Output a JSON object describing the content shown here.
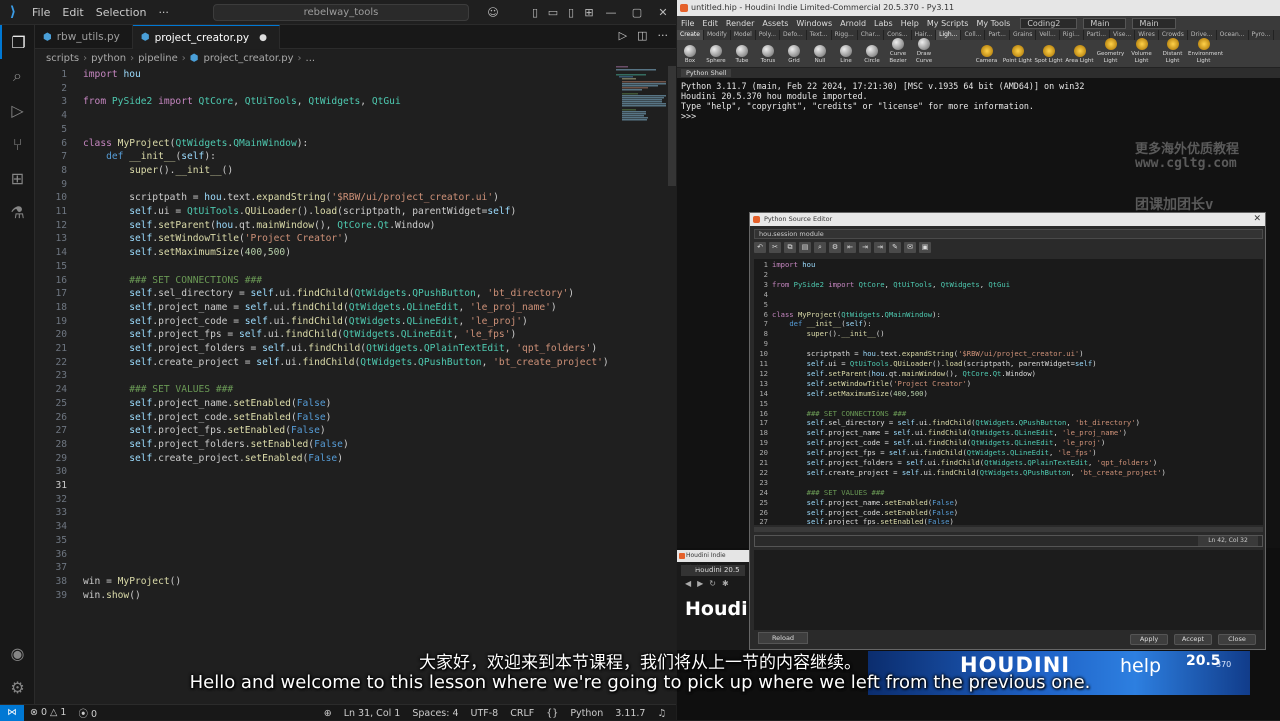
{
  "vscode": {
    "menu": [
      "File",
      "Edit",
      "Selection"
    ],
    "search": "rebelway_tools",
    "tabs": [
      {
        "label": "rbw_utils.py",
        "active": false
      },
      {
        "label": "project_creator.py",
        "active": true,
        "modified": true
      }
    ],
    "breadcrumb": [
      "scripts",
      "python",
      "pipeline",
      "project_creator.py",
      "..."
    ],
    "code": [
      {
        "n": "1",
        "t": "import hou"
      },
      {
        "n": "2",
        "t": ""
      },
      {
        "n": "3",
        "t": "from PySide2 import QtCore, QtUiTools, QtWidgets, QtGui"
      },
      {
        "n": "4",
        "t": ""
      },
      {
        "n": "5",
        "t": ""
      },
      {
        "n": "6",
        "t": "class MyProject(QtWidgets.QMainWindow):"
      },
      {
        "n": "7",
        "t": "    def __init__(self):"
      },
      {
        "n": "8",
        "t": "        super().__init__()"
      },
      {
        "n": "9",
        "t": ""
      },
      {
        "n": "10",
        "t": "        scriptpath = hou.text.expandString('$RBW/ui/project_creator.ui')"
      },
      {
        "n": "11",
        "t": "        self.ui = QtUiTools.QUiLoader().load(scriptpath, parentWidget=self)"
      },
      {
        "n": "12",
        "t": "        self.setParent(hou.qt.mainWindow(), QtCore.Qt.Window)"
      },
      {
        "n": "13",
        "t": "        self.setWindowTitle('Project Creator')"
      },
      {
        "n": "14",
        "t": "        self.setMaximumSize(400,500)"
      },
      {
        "n": "15",
        "t": ""
      },
      {
        "n": "16",
        "t": "        ### SET CONNECTIONS ###"
      },
      {
        "n": "17",
        "t": "        self.sel_directory = self.ui.findChild(QtWidgets.QPushButton, 'bt_directory')"
      },
      {
        "n": "18",
        "t": "        self.project_name = self.ui.findChild(QtWidgets.QLineEdit, 'le_proj_name')"
      },
      {
        "n": "19",
        "t": "        self.project_code = self.ui.findChild(QtWidgets.QLineEdit, 'le_proj')"
      },
      {
        "n": "20",
        "t": "        self.project_fps = self.ui.findChild(QtWidgets.QLineEdit, 'le_fps')"
      },
      {
        "n": "21",
        "t": "        self.project_folders = self.ui.findChild(QtWidgets.QPlainTextEdit, 'qpt_folders')"
      },
      {
        "n": "22",
        "t": "        self.create_project = self.ui.findChild(QtWidgets.QPushButton, 'bt_create_project')"
      },
      {
        "n": "23",
        "t": ""
      },
      {
        "n": "24",
        "t": "        ### SET VALUES ###"
      },
      {
        "n": "25",
        "t": "        self.project_name.setEnabled(False)"
      },
      {
        "n": "26",
        "t": "        self.project_code.setEnabled(False)"
      },
      {
        "n": "27",
        "t": "        self.project_fps.setEnabled(False)"
      },
      {
        "n": "28",
        "t": "        self.project_folders.setEnabled(False)"
      },
      {
        "n": "29",
        "t": "        self.create_project.setEnabled(False)"
      },
      {
        "n": "30",
        "t": ""
      },
      {
        "n": "31",
        "t": ""
      },
      {
        "n": "32",
        "t": ""
      },
      {
        "n": "33",
        "t": ""
      },
      {
        "n": "34",
        "t": ""
      },
      {
        "n": "35",
        "t": ""
      },
      {
        "n": "36",
        "t": ""
      },
      {
        "n": "37",
        "t": ""
      },
      {
        "n": "38",
        "t": "win = MyProject()"
      },
      {
        "n": "39",
        "t": "win.show()"
      }
    ],
    "current_line": "31",
    "status": {
      "errors": "0",
      "warnings": "1",
      "ports": "0",
      "position": "Ln 31, Col 1",
      "spaces": "Spaces: 4",
      "encoding": "UTF-8",
      "eol": "CRLF",
      "braces": "{}",
      "language": "Python",
      "version": "3.11.7"
    }
  },
  "houdini": {
    "title": "untitled.hip - Houdini Indie Limited-Commercial 20.5.370 - Py3.11",
    "menu": [
      "File",
      "Edit",
      "Render",
      "Assets",
      "Windows",
      "Arnold",
      "Labs",
      "Help",
      "My Scripts",
      "My Tools"
    ],
    "desktop": "Coding2",
    "main1": "Main",
    "main2": "Main",
    "shelf_tabs": [
      "Create",
      "Modify",
      "Model",
      "Poly...",
      "Defo...",
      "Text...",
      "Rigg...",
      "Char...",
      "Cons...",
      "Hair...",
      "Ligh...",
      "Coll...",
      "Part...",
      "Grains",
      "Vell...",
      "Rigi...",
      "Parti...",
      "Vise...",
      "Wires",
      "Crowds",
      "Drive...",
      "Ocean...",
      "Pyro..."
    ],
    "tools_left": [
      "Box",
      "Sphere",
      "Tube",
      "Torus",
      "Grid",
      "Null",
      "Line",
      "Circle",
      "Curve Bezier",
      "Draw Curve"
    ],
    "tools_right": [
      "Camera",
      "Point Light",
      "Spot Light",
      "Area Light",
      "Geometry Light",
      "Volume Light",
      "Distant Light",
      "Environment Light"
    ],
    "python_tab": "Python Shell",
    "shell": [
      "Python 3.11.7 (main, Feb 22 2024, 17:21:30) [MSC v.1935 64 bit (AMD64)] on win32",
      "Houdini 20.5.370 hou module imported.",
      "Type \"help\", \"copyright\", \"credits\" or \"license\" for more information.",
      ">>>"
    ],
    "watermark1": "更多海外优质教程",
    "watermark2": "www.cgltg.com",
    "watermark3": "团课加团长v"
  },
  "pse": {
    "title": "Python Source Editor",
    "module": "hou.session module",
    "toolbar": [
      "↶",
      "✂",
      "⧉",
      "▤",
      "⌕",
      "⚙",
      "⇤",
      "⇥",
      "⇥",
      "✎",
      "✉",
      "▣"
    ],
    "code": [
      {
        "n": "1",
        "t": "import hou"
      },
      {
        "n": "2",
        "t": ""
      },
      {
        "n": "3",
        "t": "from PySide2 import QtCore, QtUiTools, QtWidgets, QtGui"
      },
      {
        "n": "4",
        "t": ""
      },
      {
        "n": "5",
        "t": ""
      },
      {
        "n": "6",
        "t": "class MyProject(QtWidgets.QMainWindow):"
      },
      {
        "n": "7",
        "t": "    def __init__(self):"
      },
      {
        "n": "8",
        "t": "        super().__init__()"
      },
      {
        "n": "9",
        "t": ""
      },
      {
        "n": "10",
        "t": "        scriptpath = hou.text.expandString('$RBW/ui/project_creator.ui')"
      },
      {
        "n": "11",
        "t": "        self.ui = QtUiTools.QUiLoader().load(scriptpath, parentWidget=self)"
      },
      {
        "n": "12",
        "t": "        self.setParent(hou.qt.mainWindow(), QtCore.Qt.Window)"
      },
      {
        "n": "13",
        "t": "        self.setWindowTitle('Project Creator')"
      },
      {
        "n": "14",
        "t": "        self.setMaximumSize(400,500)"
      },
      {
        "n": "15",
        "t": ""
      },
      {
        "n": "16",
        "t": "        ### SET CONNECTIONS ###"
      },
      {
        "n": "17",
        "t": "        self.sel_directory = self.ui.findChild(QtWidgets.QPushButton, 'bt_directory')"
      },
      {
        "n": "18",
        "t": "        self.project_name = self.ui.findChild(QtWidgets.QLineEdit, 'le_proj_name')"
      },
      {
        "n": "19",
        "t": "        self.project_code = self.ui.findChild(QtWidgets.QLineEdit, 'le_proj')"
      },
      {
        "n": "20",
        "t": "        self.project_fps = self.ui.findChild(QtWidgets.QLineEdit, 'le_fps')"
      },
      {
        "n": "21",
        "t": "        self.project_folders = self.ui.findChild(QtWidgets.QPlainTextEdit, 'qpt_folders')"
      },
      {
        "n": "22",
        "t": "        self.create_project = self.ui.findChild(QtWidgets.QPushButton, 'bt_create_project')"
      },
      {
        "n": "23",
        "t": ""
      },
      {
        "n": "24",
        "t": "        ### SET VALUES ###"
      },
      {
        "n": "25",
        "t": "        self.project_name.setEnabled(False)"
      },
      {
        "n": "26",
        "t": "        self.project_code.setEnabled(False)"
      },
      {
        "n": "27",
        "t": "        self.project_fps.setEnabled(False)"
      }
    ],
    "linecol": "Ln 42, Col 32",
    "buttons": {
      "reload": "Reload",
      "apply": "Apply",
      "accept": "Accept",
      "close": "Close"
    }
  },
  "hsmall": {
    "title": "Houdini Indie Limited",
    "tab": "Houdini 20.5",
    "brand": "Houdi"
  },
  "banner": {
    "houdini": "HOUDINI",
    "help": "help",
    "version": "20.5",
    "build": "370"
  },
  "subtitles": {
    "zh": "大家好，欢迎来到本节课程，我们将从上一节的内容继续。",
    "en": "Hello and welcome to this lesson where we're going to pick up where we left from the previous one."
  },
  "colors": {
    "keyword": "#c586c0",
    "def": "#569cd6",
    "class_name": "#4ec9b0",
    "function": "#dcdcaa",
    "string": "#ce9178",
    "comment": "#6a9955",
    "constant": "#569cd6",
    "accent": "#0078d4"
  }
}
